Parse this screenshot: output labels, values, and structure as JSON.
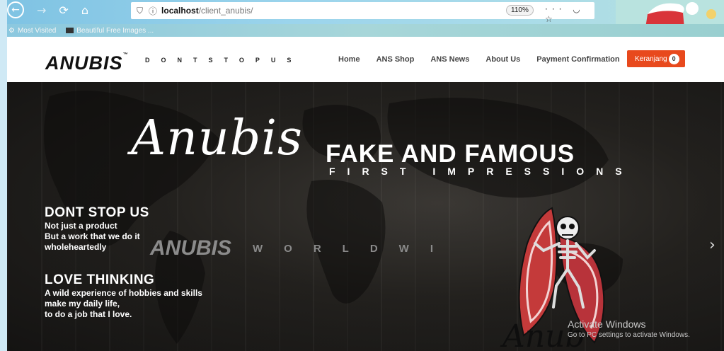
{
  "browser": {
    "url_host": "localhost",
    "url_path": "/client_anubis/",
    "zoom": "110%",
    "bookmarks": [
      {
        "label": "Most Visited"
      },
      {
        "label": "Beautiful Free Images ..."
      }
    ]
  },
  "site": {
    "logo": "ANUBIS",
    "logo_mark": "™",
    "tagline": "DONTSTOPUS",
    "menu": [
      "Home",
      "ANS Shop",
      "ANS News",
      "About Us",
      "Payment Confirmation"
    ],
    "cart_label": "Keranjang",
    "cart_count": "0",
    "accent_color": "#e8491d"
  },
  "hero": {
    "script_title": "Anubis",
    "headline": "FAKE AND FAMOUS",
    "subheadline": "FIRST IMPRESSIONS",
    "block1": {
      "heading": "DONT STOP US",
      "lines": [
        "Not just a product",
        "But a work that we do it",
        "wholeheartedly"
      ]
    },
    "block2": {
      "heading": "LOVE THINKING",
      "lines": [
        "A wild experience of hobbies and skills",
        "make my daily life,",
        "to do a job that I love."
      ]
    },
    "worldwide_logo": "ANUBIS",
    "worldwide_text": "WORLDWI",
    "next_icon": "chevron-right-icon"
  },
  "watermark": {
    "title": "Activate Windows",
    "subtitle": "Go to PC settings to activate Windows."
  }
}
